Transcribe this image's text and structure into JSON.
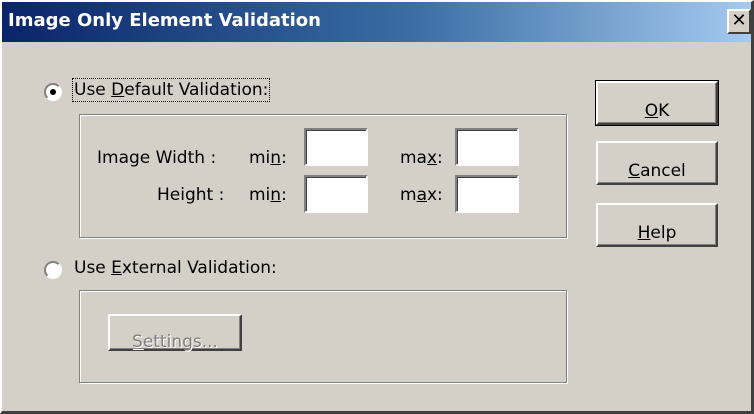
{
  "window": {
    "title": "Image Only Element Validation",
    "close_glyph": "✕"
  },
  "default_validation": {
    "label_pre": "Use ",
    "label_key": "D",
    "label_post": "efault Validation:",
    "selected": true,
    "image_width_label": "Image Width :",
    "height_label": "Height :",
    "width_min": {
      "pre": "mi",
      "key": "n",
      "post": ":",
      "value": ""
    },
    "width_max": {
      "pre": "ma",
      "key": "x",
      "post": ":",
      "value": ""
    },
    "height_min": {
      "pre": "mi",
      "key": "n",
      "post": ":",
      "value": ""
    },
    "height_max": {
      "pre": "m",
      "key": "a",
      "post": "x:",
      "value": ""
    }
  },
  "external_validation": {
    "label_pre": "Use ",
    "label_key": "E",
    "label_post": "xternal Validation:",
    "selected": false,
    "settings_key": "S",
    "settings_post": "ettings..."
  },
  "buttons": {
    "ok_key": "O",
    "ok_post": "K",
    "cancel_key": "C",
    "cancel_post": "ancel",
    "help_key": "H",
    "help_post": "elp"
  }
}
